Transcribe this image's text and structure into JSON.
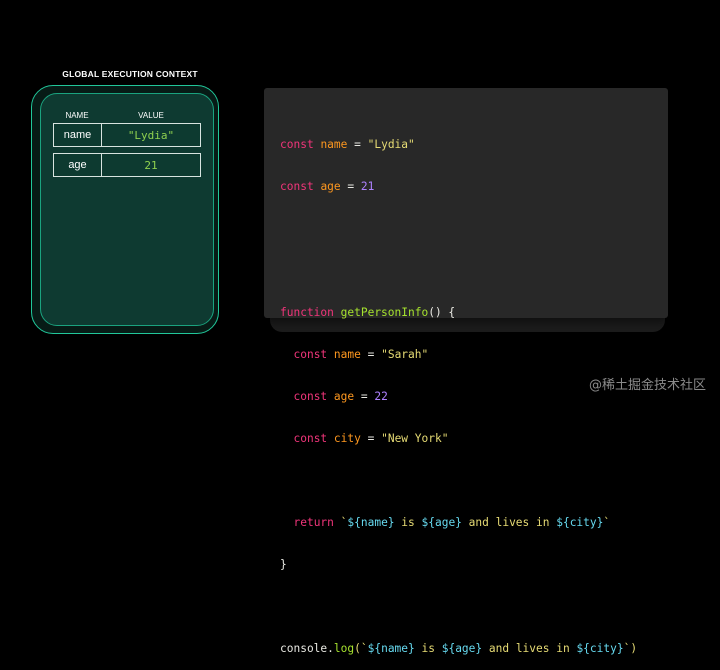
{
  "context": {
    "title": "GLOBAL EXECUTION CONTEXT",
    "headers": {
      "name": "NAME",
      "value": "VALUE"
    },
    "rows": [
      {
        "name": "name",
        "value": "\"Lydia\""
      },
      {
        "name": "age",
        "value": "21"
      }
    ]
  },
  "code": {
    "line1": {
      "kw": "const",
      "var": "name",
      "op": " = ",
      "val": "\"Lydia\""
    },
    "line2": {
      "kw": "const",
      "var": "age",
      "op": " = ",
      "val": "21"
    },
    "line5": {
      "kw": "function",
      "fn": "getPersonInfo",
      "rest": "() {"
    },
    "line6": {
      "kw": "const",
      "var": "name",
      "op": " = ",
      "val": "\"Sarah\""
    },
    "line7": {
      "kw": "const",
      "var": "age",
      "op": " = ",
      "val": "22"
    },
    "line8": {
      "kw": "const",
      "var": "city",
      "op": " = ",
      "val": "\"New York\""
    },
    "line10": {
      "kw": "return",
      "t1": " `",
      "i1": "${name}",
      "t2": " is ",
      "i2": "${age}",
      "t3": " and lives in ",
      "i3": "${city}",
      "t4": "`"
    },
    "line11": "}",
    "line13": {
      "obj": "console",
      "dot": ".",
      "fn": "log",
      "open": "(`",
      "i1": "${name}",
      "t2": " is ",
      "i2": "${age}",
      "t3": " and lives in ",
      "i3": "${city}",
      "close": "`)"
    }
  },
  "watermark": "@稀土掘金技术社区",
  "colors": {
    "keyword": "#f0357a",
    "function": "#a6e22e",
    "string": "#e6db74",
    "number": "#ae81ff",
    "variable": "#fd971f",
    "interpolation": "#66d9ef",
    "context_border": "#21c79a",
    "context_fill": "#0e3a31"
  }
}
